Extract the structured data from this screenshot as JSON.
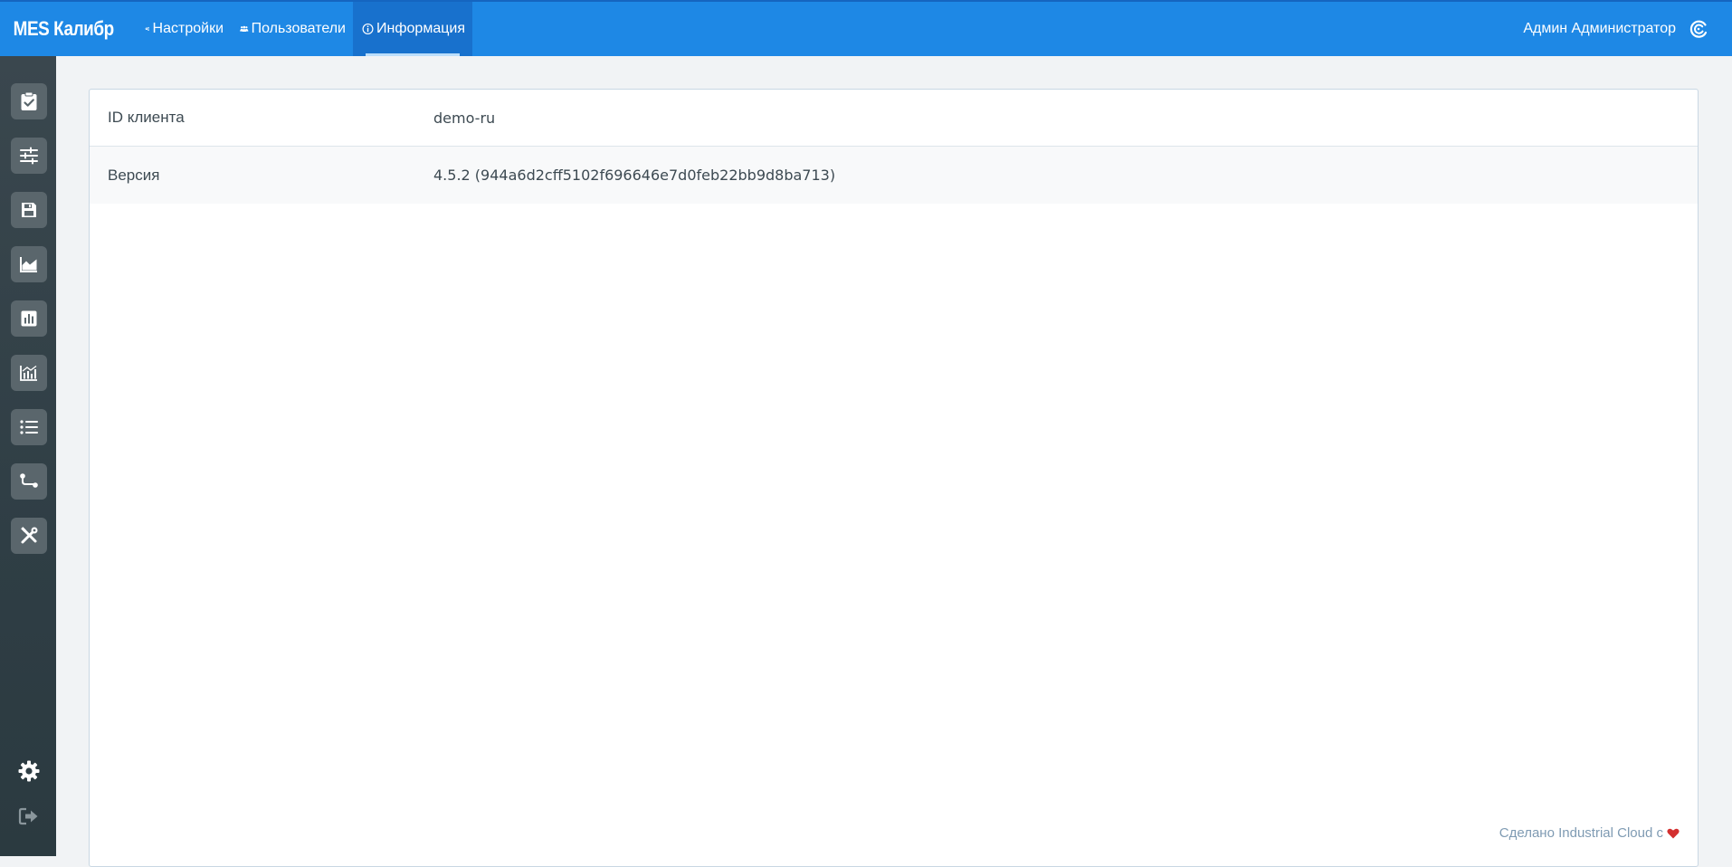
{
  "app": {
    "brand": "MES Калибр"
  },
  "topnav": {
    "items": [
      {
        "label": "Настройки",
        "icon": "gears-icon"
      },
      {
        "label": "Пользователи",
        "icon": "users-icon"
      },
      {
        "label": "Информация",
        "icon": "info-circle-icon",
        "active": true
      }
    ],
    "user_name": "Админ Администратор",
    "logo_icon": "industrial-cloud-logo-icon"
  },
  "sidebar": {
    "items": [
      {
        "icon": "clipboard-check-icon"
      },
      {
        "icon": "sliders-icon"
      },
      {
        "icon": "floppy-disk-icon"
      },
      {
        "icon": "area-chart-icon"
      },
      {
        "icon": "bar-chart-icon"
      },
      {
        "icon": "line-bar-chart-icon"
      },
      {
        "icon": "list-icon"
      },
      {
        "icon": "flow-route-icon"
      },
      {
        "icon": "tools-icon"
      }
    ],
    "bottom": [
      {
        "icon": "gear-icon"
      },
      {
        "icon": "logout-icon"
      }
    ]
  },
  "info": {
    "rows": [
      {
        "label": "ID клиента",
        "value": "demo-ru"
      },
      {
        "label": "Версия",
        "value": "4.5.2 (944a6d2cff5102f696646e7d0feb22bb9d8ba713)"
      }
    ]
  },
  "footer": {
    "credit": "Сделано Industrial Cloud с",
    "heart_color": "#d32f2f"
  },
  "colors": {
    "topbar": "#1e88e5",
    "sidebar": "#2f3e45",
    "sidebar_button": "#5a666c"
  }
}
